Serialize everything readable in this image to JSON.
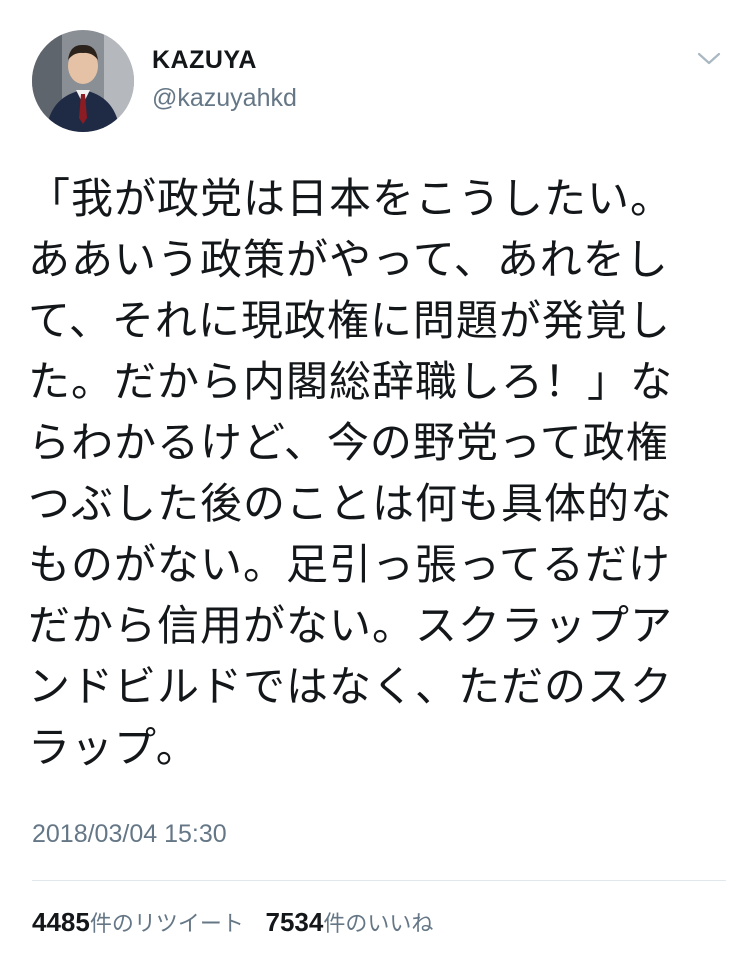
{
  "author": {
    "name": "KAZUYA",
    "handle": "@kazuyahkd",
    "avatar": "profile-photo"
  },
  "menu": {
    "icon": "chevron-down-icon"
  },
  "tweet": {
    "text": "「我が政党は日本をこうしたい。\nああいう政策がやって、あれをし\nて、それに現政権に問題が発覚し\nた。だから内閣総辞職しろ！」な\nらわかるけど、今の野党って政権\nつぶした後のことは何も具体的な\nものがない。足引っ張ってるだけ\nだから信用がない。スクラップア\nンドビルドではなく、ただのスク\nラップ。",
    "timestamp": "2018/03/04 15:30"
  },
  "stats": {
    "retweets_count": "4485",
    "retweets_label": "件のリツイート",
    "likes_count": "7534",
    "likes_label": "件のいいね"
  },
  "colors": {
    "text_primary": "#14171a",
    "text_secondary": "#657786",
    "divider": "#e1e8ed"
  }
}
